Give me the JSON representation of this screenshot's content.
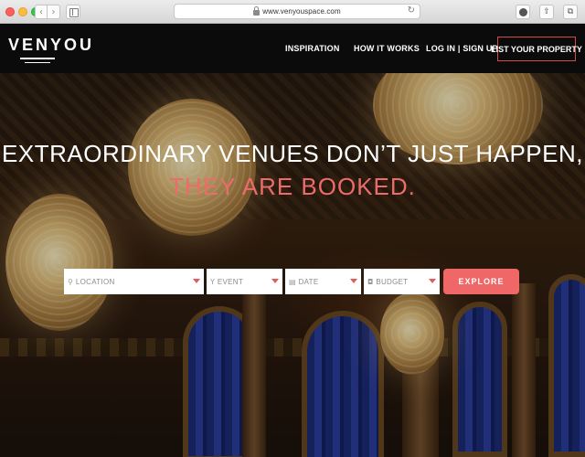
{
  "browser": {
    "url": "www.venyouspace.com"
  },
  "header": {
    "logo": "VENYOU",
    "nav": [
      {
        "label": "INSPIRATION"
      },
      {
        "label": "HOW IT WORKS"
      },
      {
        "label": "LOG IN | SIGN UP"
      }
    ],
    "cta": "LIST YOUR PROPERTY"
  },
  "hero": {
    "line1": "EXTRAORDINARY VENUES DON’T JUST HAPPEN,",
    "line2": "THEY ARE BOOKED."
  },
  "search": {
    "fields": [
      {
        "placeholder": "LOCATION",
        "icon": "map-pin-icon"
      },
      {
        "placeholder": "EVENT",
        "icon": "glass-icon"
      },
      {
        "placeholder": "DATE",
        "icon": "calendar-icon"
      },
      {
        "placeholder": "BUDGET",
        "icon": "wallet-icon"
      }
    ],
    "button": "EXPLORE"
  },
  "colors": {
    "accent": "#ef6767",
    "headline_accent": "#ec6b6b",
    "header_bg": "#0b0b0b"
  }
}
